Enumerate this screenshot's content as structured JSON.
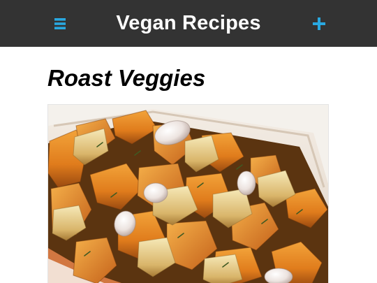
{
  "header": {
    "title": "Vegan Recipes",
    "menu_icon": "menu-icon",
    "add_icon": "plus-icon",
    "background": "#333333",
    "accent": "#29a8e0"
  },
  "recipe": {
    "title": "Roast Veggies",
    "image_subject": "roasted vegetables in a baking dish"
  }
}
